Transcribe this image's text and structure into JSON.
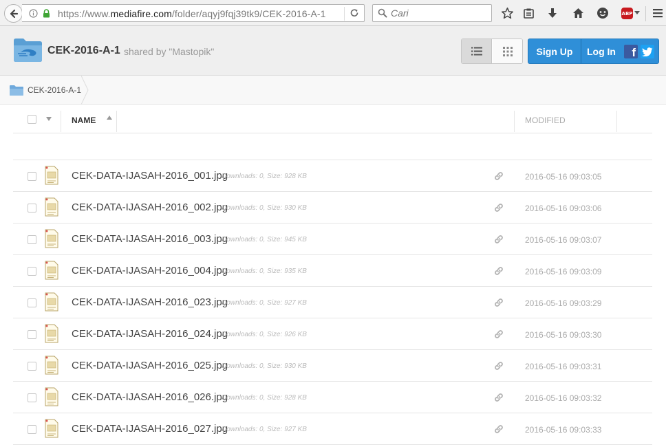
{
  "browser": {
    "url_prefix": "https://www.",
    "url_domain": "mediafire.com",
    "url_path": "/folder/aqyj9fqj39tk9/CEK-2016-A-1",
    "search_placeholder": "Cari",
    "abp_label": "ABP"
  },
  "header": {
    "folder_title": "CEK-2016-A-1",
    "shared_by": "shared by \"Mastopik\"",
    "signup_label": "Sign Up",
    "login_label": "Log In",
    "fb_label": "f"
  },
  "breadcrumb": {
    "label": "CEK-2016-A-1"
  },
  "table": {
    "col_name": "NAME",
    "col_modified": "MODIFIED"
  },
  "files": [
    {
      "name": "CEK-DATA-IJASAH-2016_001.jpg",
      "meta": "Downloads: 0, Size: 928 KB",
      "modified": "2016-05-16 09:03:05"
    },
    {
      "name": "CEK-DATA-IJASAH-2016_002.jpg",
      "meta": "Downloads: 0, Size: 930 KB",
      "modified": "2016-05-16 09:03:06"
    },
    {
      "name": "CEK-DATA-IJASAH-2016_003.jpg",
      "meta": "Downloads: 0, Size: 945 KB",
      "modified": "2016-05-16 09:03:07"
    },
    {
      "name": "CEK-DATA-IJASAH-2016_004.jpg",
      "meta": "Downloads: 0, Size: 935 KB",
      "modified": "2016-05-16 09:03:09"
    },
    {
      "name": "CEK-DATA-IJASAH-2016_023.jpg",
      "meta": "Downloads: 0, Size: 927 KB",
      "modified": "2016-05-16 09:03:29"
    },
    {
      "name": "CEK-DATA-IJASAH-2016_024.jpg",
      "meta": "Downloads: 0, Size: 926 KB",
      "modified": "2016-05-16 09:03:30"
    },
    {
      "name": "CEK-DATA-IJASAH-2016_025.jpg",
      "meta": "Downloads: 0, Size: 930 KB",
      "modified": "2016-05-16 09:03:31"
    },
    {
      "name": "CEK-DATA-IJASAH-2016_026.jpg",
      "meta": "Downloads: 0, Size: 928 KB",
      "modified": "2016-05-16 09:03:32"
    },
    {
      "name": "CEK-DATA-IJASAH-2016_027.jpg",
      "meta": "Downloads: 0, Size: 927 KB",
      "modified": "2016-05-16 09:03:33"
    }
  ],
  "colors": {
    "accent_blue": "#2f8fd8",
    "facebook": "#3b5aa0",
    "twitter": "#1da1f2",
    "abp_red": "#c8191e"
  },
  "icons": {
    "back": "back-arrow-icon",
    "info": "info-icon",
    "lock": "lock-icon",
    "reload": "reload-icon",
    "search": "search-icon",
    "bookmark": "star-icon",
    "reading_list": "clipboard-icon",
    "download": "download-icon",
    "home": "home-icon",
    "hello": "chat-icon",
    "menu": "hamburger-menu-icon",
    "list_view": "list-view-icon",
    "grid_view": "grid-view-icon",
    "file": "image-file-icon",
    "share_link": "link-icon"
  }
}
